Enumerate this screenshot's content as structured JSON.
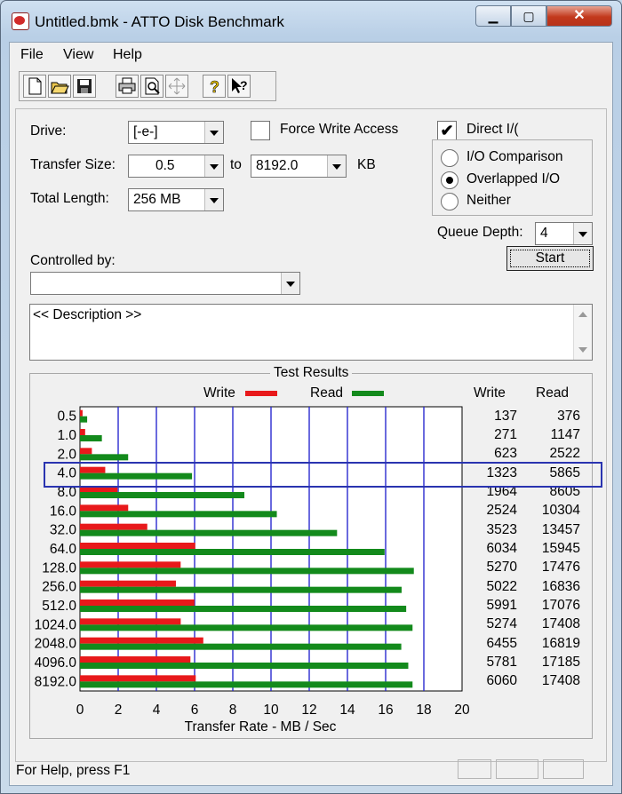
{
  "window": {
    "title": "Untitled.bmk - ATTO Disk Benchmark",
    "minimize": "▁",
    "maximize": "▢",
    "close": "✕"
  },
  "menu": [
    "File",
    "View",
    "Help"
  ],
  "toolbar_icons": [
    "new-file-icon",
    "open-folder-icon",
    "save-icon",
    "print-icon",
    "print-preview-icon",
    "move-icon",
    "help-icon",
    "context-help-icon"
  ],
  "form": {
    "drive_label": "Drive:",
    "drive_value": "[-e-]",
    "transfer_size_label": "Transfer Size:",
    "transfer_from": "0.5",
    "to_label": "to",
    "transfer_to": "8192.0",
    "kb_label": "KB",
    "total_length_label": "Total Length:",
    "total_length_value": "256 MB",
    "force_write_label": "Force Write Access",
    "direct_io_label": "Direct I/(",
    "io_comparison_label": "I/O Comparison",
    "overlapped_label": "Overlapped I/O",
    "neither_label": "Neither",
    "queue_depth_label": "Queue Depth:",
    "queue_depth_value": "4",
    "controlled_by_label": "Controlled by:",
    "controlled_by_value": "",
    "start_label": "Start",
    "description": "<< Description >>"
  },
  "results": {
    "title": "Test Results",
    "legend_write": "Write",
    "legend_read": "Read",
    "col_write": "Write",
    "col_read": "Read",
    "rows": [
      {
        "size": "0.5",
        "write": "137",
        "read": "376"
      },
      {
        "size": "1.0",
        "write": "271",
        "read": "1147"
      },
      {
        "size": "2.0",
        "write": "623",
        "read": "2522"
      },
      {
        "size": "4.0",
        "write": "1323",
        "read": "5865"
      },
      {
        "size": "8.0",
        "write": "1964",
        "read": "8605"
      },
      {
        "size": "16.0",
        "write": "2524",
        "read": "10304"
      },
      {
        "size": "32.0",
        "write": "3523",
        "read": "13457"
      },
      {
        "size": "64.0",
        "write": "6034",
        "read": "15945"
      },
      {
        "size": "128.0",
        "write": "5270",
        "read": "17476"
      },
      {
        "size": "256.0",
        "write": "5022",
        "read": "16836"
      },
      {
        "size": "512.0",
        "write": "5991",
        "read": "17076"
      },
      {
        "size": "1024.0",
        "write": "5274",
        "read": "17408"
      },
      {
        "size": "2048.0",
        "write": "6455",
        "read": "16819"
      },
      {
        "size": "4096.0",
        "write": "5781",
        "read": "17185"
      },
      {
        "size": "8192.0",
        "write": "6060",
        "read": "17408"
      }
    ],
    "highlighted_row": "4.0"
  },
  "chart_data": {
    "type": "bar",
    "orientation": "horizontal",
    "title": "Test Results",
    "xlabel": "Transfer Rate - MB / Sec",
    "categories": [
      "0.5",
      "1.0",
      "2.0",
      "4.0",
      "8.0",
      "16.0",
      "32.0",
      "64.0",
      "128.0",
      "256.0",
      "512.0",
      "1024.0",
      "2048.0",
      "4096.0",
      "8192.0"
    ],
    "series": [
      {
        "name": "Write",
        "color": "#e8191b",
        "values": [
          0.137,
          0.271,
          0.623,
          1.323,
          1.964,
          2.524,
          3.523,
          6.034,
          5.27,
          5.022,
          5.991,
          5.274,
          6.455,
          5.781,
          6.06
        ]
      },
      {
        "name": "Read",
        "color": "#138a1c",
        "values": [
          0.376,
          1.147,
          2.522,
          5.865,
          8.605,
          10.304,
          13.457,
          15.945,
          17.476,
          16.836,
          17.076,
          17.408,
          16.819,
          17.185,
          17.408
        ]
      }
    ],
    "xlim": [
      0,
      20
    ],
    "xticks": [
      "0",
      "2",
      "4",
      "6",
      "8",
      "10",
      "12",
      "14",
      "16",
      "18",
      "20"
    ],
    "grid": true
  },
  "status": {
    "text": "For Help, press F1"
  }
}
